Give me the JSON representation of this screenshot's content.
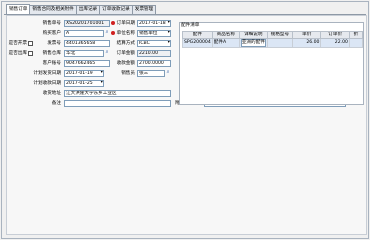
{
  "tabs": [
    {
      "label": "销售订单",
      "active": true
    },
    {
      "label": "销售合同及相关附件",
      "active": false
    },
    {
      "label": "出库记录",
      "active": false
    },
    {
      "label": "订单收款记录",
      "active": false
    },
    {
      "label": "发票管理",
      "active": false
    }
  ],
  "form": {
    "order_no_label": "销售单号",
    "order_no": "XS20201701001",
    "order_date_label": "订单日期",
    "order_date": "2017-01-18",
    "customer_label": "购买客户",
    "customer": "A",
    "unit_label": "单位名称",
    "unit": "销售单位",
    "invoice_label": "发票号",
    "invoice_no": "4401365658",
    "has_invoice_label": "是否开票",
    "is_outbound_label": "是否出库",
    "settle_label": "结算方式",
    "settle": "ICBC",
    "warehouse_label": "销售仓库",
    "warehouse": "华北",
    "total_label": "订单金额",
    "total": "2210.00",
    "account_label": "客户账号",
    "account": "9047662465",
    "received_label": "收款金额",
    "received": "2700.0000",
    "ship_date_label": "计划发货日期",
    "ship_date": "2017-01-19",
    "salesman_label": "销售员",
    "salesman": "张三",
    "recv_date_label": "计划收款日期",
    "recv_date": "2017-01-25",
    "address_label": "收货地址",
    "address": "江大洪隆大学东乡工业区",
    "remark_label": "备注",
    "remark": "",
    "attach_label": "附检说明",
    "attach": ""
  },
  "detail": {
    "title": "配件清单",
    "columns": [
      "配件",
      "商品名称",
      "详细说明",
      "规格型号",
      "单价",
      "订单价",
      "折"
    ],
    "rows": [
      [
        "SPG200004",
        "配件A",
        "亚洲的配件",
        "",
        "26.00",
        "22.00",
        ""
      ]
    ]
  },
  "colors": {
    "selected_row": "#dbe6f5",
    "required_dot": "#d02020",
    "input_border": "#7f9db9"
  }
}
